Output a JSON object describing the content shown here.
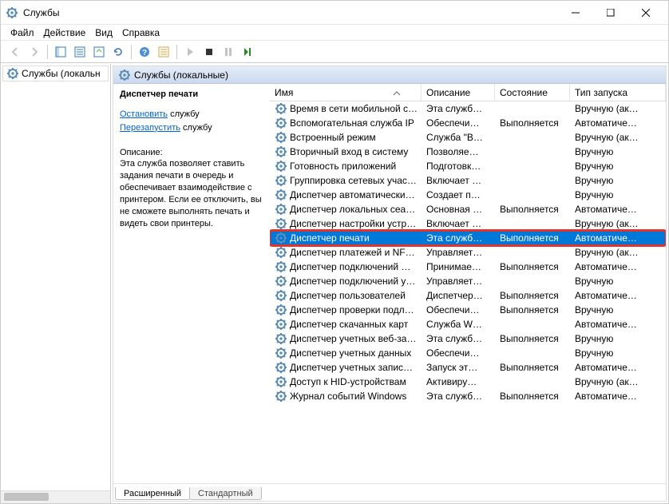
{
  "window": {
    "title": "Службы"
  },
  "menu": {
    "file": "Файл",
    "action": "Действие",
    "view": "Вид",
    "help": "Справка"
  },
  "left_tree": {
    "root": "Службы (локальн"
  },
  "panel": {
    "title": "Службы (локальные)"
  },
  "info": {
    "service_name": "Диспетчер печати",
    "stop_link": "Остановить",
    "stop_suffix": " службу",
    "restart_link": "Перезапустить",
    "restart_suffix": " службу",
    "desc_label": "Описание:",
    "desc_text": "Эта служба позволяет ставить задания печати в очередь и обеспечивает взаимодействие с принтером. Если ее отключить, вы не сможете выполнять печать и видеть свои принтеры."
  },
  "columns": {
    "name": "Имя",
    "desc": "Описание",
    "state": "Состояние",
    "startup": "Тип запуска"
  },
  "tabs": {
    "extended": "Расширенный",
    "standard": "Стандартный"
  },
  "services": [
    {
      "name": "Время в сети мобильной с…",
      "desc": "Эта служб…",
      "state": "",
      "startup": "Вручную (ак…"
    },
    {
      "name": "Вспомогательная служба IP",
      "desc": "Обеспечи…",
      "state": "Выполняется",
      "startup": "Автоматиче…"
    },
    {
      "name": "Встроенный режим",
      "desc": "Служба \"В…",
      "state": "",
      "startup": "Вручную (ак…"
    },
    {
      "name": "Вторичный вход в систему",
      "desc": "Позволяе…",
      "state": "",
      "startup": "Вручную"
    },
    {
      "name": "Готовность приложений",
      "desc": "Подготовк…",
      "state": "",
      "startup": "Вручную"
    },
    {
      "name": "Группировка сетевых учас…",
      "desc": "Включает …",
      "state": "",
      "startup": "Вручную"
    },
    {
      "name": "Диспетчер автоматически…",
      "desc": "Создает п…",
      "state": "",
      "startup": "Вручную"
    },
    {
      "name": "Диспетчер локальных сеа…",
      "desc": "Основная …",
      "state": "Выполняется",
      "startup": "Автоматиче…"
    },
    {
      "name": "Диспетчер настройки устр…",
      "desc": "Включает …",
      "state": "",
      "startup": "Вручную (ак…"
    },
    {
      "name": "Диспетчер печати",
      "desc": "Эта служб…",
      "state": "Выполняется",
      "startup": "Автоматиче…",
      "selected": true,
      "highlighted": true
    },
    {
      "name": "Диспетчер платежей и NF…",
      "desc": "Управляет…",
      "state": "",
      "startup": "Вручную (ак…"
    },
    {
      "name": "Диспетчер подключений …",
      "desc": "Принимае…",
      "state": "Выполняется",
      "startup": "Автоматиче…"
    },
    {
      "name": "Диспетчер подключений у…",
      "desc": "Управляет…",
      "state": "",
      "startup": "Вручную"
    },
    {
      "name": "Диспетчер пользователей",
      "desc": "Диспетчер…",
      "state": "Выполняется",
      "startup": "Автоматиче…"
    },
    {
      "name": "Диспетчер проверки подл…",
      "desc": "Обеспечи…",
      "state": "Выполняется",
      "startup": "Вручную"
    },
    {
      "name": "Диспетчер скачанных карт",
      "desc": "Служба W…",
      "state": "",
      "startup": "Автоматиче…"
    },
    {
      "name": "Диспетчер учетных веб-за…",
      "desc": "Эта служб…",
      "state": "Выполняется",
      "startup": "Вручную"
    },
    {
      "name": "Диспетчер учетных данных",
      "desc": "Обеспечи…",
      "state": "",
      "startup": "Вручную"
    },
    {
      "name": "Диспетчер учетных запис…",
      "desc": "Запуск эт…",
      "state": "Выполняется",
      "startup": "Автоматиче…"
    },
    {
      "name": "Доступ к HID-устройствам",
      "desc": "Активиру…",
      "state": "",
      "startup": "Вручную (ак…"
    },
    {
      "name": "Журнал событий Windows",
      "desc": "Эта служб…",
      "state": "Выполняется",
      "startup": "Автоматиче…"
    }
  ]
}
